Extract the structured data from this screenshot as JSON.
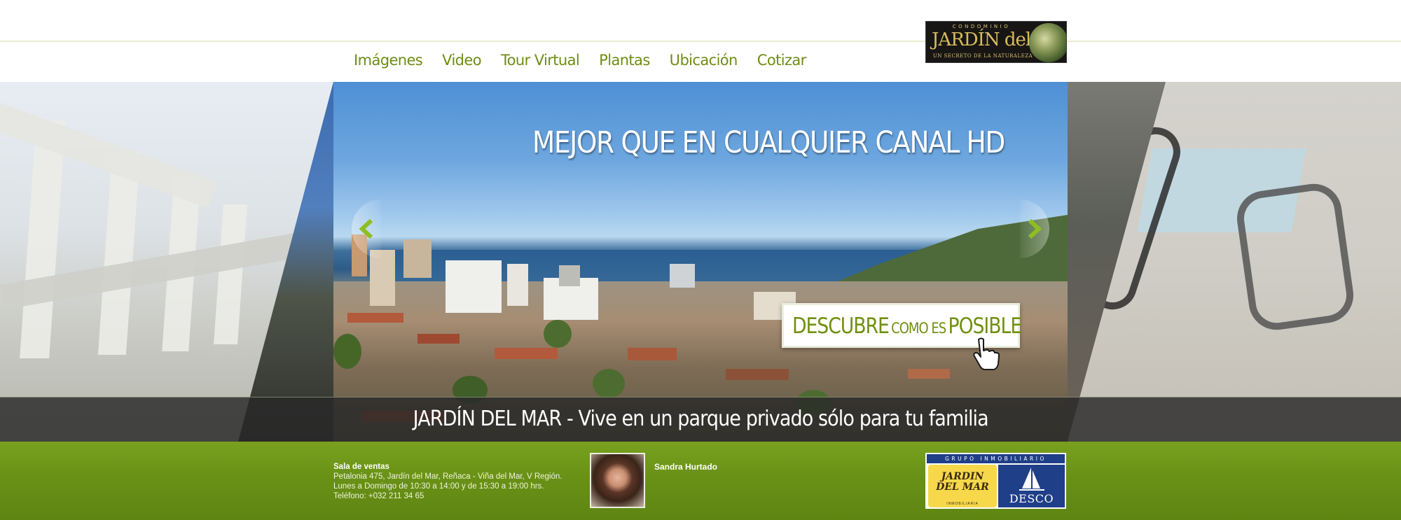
{
  "header": {
    "logo": {
      "top_text": "CONDOMINIO",
      "main_text": "JARDÍN del MAR",
      "sub_text": "UN SECRETO DE LA NATURALEZA"
    },
    "nav": [
      {
        "label": "Imágenes"
      },
      {
        "label": "Video"
      },
      {
        "label": "Tour Virtual"
      },
      {
        "label": "Plantas"
      },
      {
        "label": "Ubicación"
      },
      {
        "label": "Cotizar"
      }
    ]
  },
  "hero": {
    "headline": "MEJOR QUE EN CUALQUIER CANAL HD",
    "cta": {
      "word1": "DESCUBRE",
      "word2": "COMO ES",
      "word3": "POSIBLE"
    },
    "caption": "JARDÍN DEL MAR - Vive en un parque privado sólo para tu familia"
  },
  "footer": {
    "sales": {
      "title": "Sala de ventas",
      "address": "Petalonia 475, Jardín del Mar, Reñaca - Viña del Mar, V Región.",
      "hours": "Lunes a Domingo de 10:30 a 14:00 y de 15:30 a 19:00 hrs.",
      "phone": "Teléfono: +032 211 34 65"
    },
    "agent_name": "Sandra Hurtado",
    "partner_logo": {
      "header": "GRUPO INMOBILIARIO",
      "jdm_text": "JARDIN DEL MAR",
      "jdm_sub": "INMOBILIARIA",
      "desco_text": "DESCO"
    }
  },
  "colors": {
    "nav_green": "#6f8c14",
    "footer_green": "#6a9116",
    "caption_bar": "#282828"
  },
  "icons": {
    "prev": "chevron-left-icon",
    "next": "chevron-right-icon",
    "cursor": "hand-cursor-icon"
  }
}
